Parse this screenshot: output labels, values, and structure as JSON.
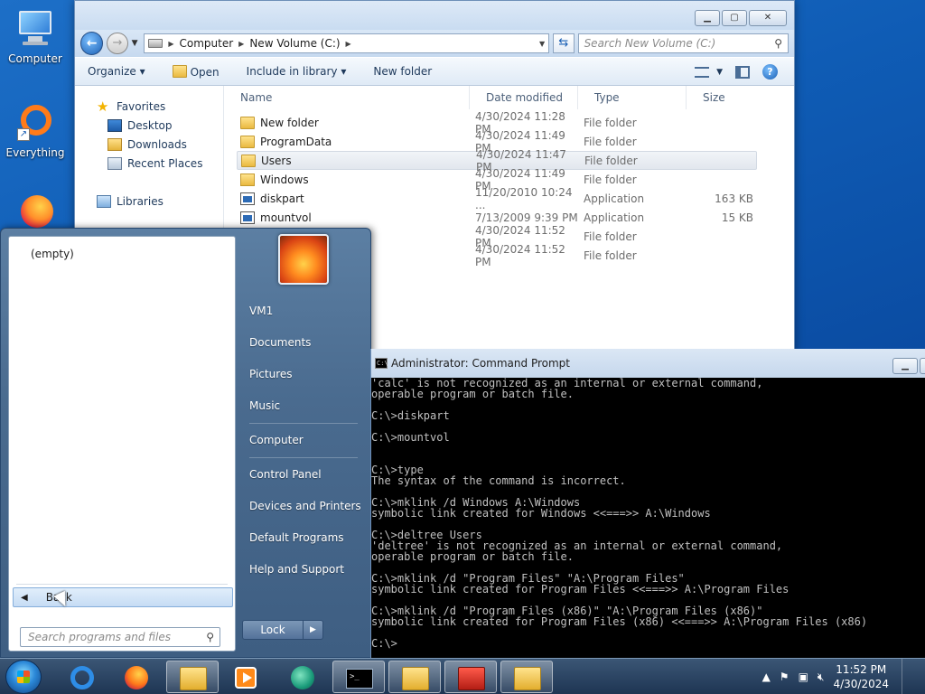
{
  "desktop": {
    "icons": [
      {
        "label": "Computer"
      },
      {
        "label": "Everything"
      }
    ]
  },
  "explorer": {
    "breadcrumb": [
      "Computer",
      "New Volume (C:)"
    ],
    "search_placeholder": "Search New Volume (C:)",
    "toolbar": {
      "organize": "Organize",
      "open": "Open",
      "include": "Include in library",
      "new_folder": "New folder"
    },
    "nav": {
      "favorites": "Favorites",
      "desktop": "Desktop",
      "downloads": "Downloads",
      "recent": "Recent Places",
      "libraries": "Libraries"
    },
    "columns": {
      "name": "Name",
      "date": "Date modified",
      "type": "Type",
      "size": "Size"
    },
    "files": [
      {
        "name": "New folder",
        "date": "4/30/2024 11:28 PM",
        "type": "File folder",
        "size": "",
        "icon": "folder"
      },
      {
        "name": "ProgramData",
        "date": "4/30/2024 11:49 PM",
        "type": "File folder",
        "size": "",
        "icon": "folder"
      },
      {
        "name": "Users",
        "date": "4/30/2024 11:47 PM",
        "type": "File folder",
        "size": "",
        "icon": "folder",
        "selected": true
      },
      {
        "name": "Windows",
        "date": "4/30/2024 11:49 PM",
        "type": "File folder",
        "size": "",
        "icon": "folder-link"
      },
      {
        "name": "diskpart",
        "date": "11/20/2010 10:24 ...",
        "type": "Application",
        "size": "163 KB",
        "icon": "app"
      },
      {
        "name": "mountvol",
        "date": "7/13/2009 9:39 PM",
        "type": "Application",
        "size": "15 KB",
        "icon": "app"
      },
      {
        "name": "",
        "date": "4/30/2024 11:52 PM",
        "type": "File folder",
        "size": "",
        "icon": "none"
      },
      {
        "name": "",
        "date": "4/30/2024 11:52 PM",
        "type": "File folder",
        "size": "",
        "icon": "none"
      }
    ]
  },
  "start_menu": {
    "empty_label": "(empty)",
    "back_label": "Back",
    "search_placeholder": "Search programs and files",
    "right_items": [
      "VM1",
      "Documents",
      "Pictures",
      "Music",
      "Computer",
      "Control Panel",
      "Devices and Printers",
      "Default Programs",
      "Help and Support"
    ],
    "lock_label": "Lock"
  },
  "cmd": {
    "title": "Administrator: Command Prompt",
    "output": "'calc' is not recognized as an internal or external command,\noperable program or batch file.\n\nC:\\>diskpart\n\nC:\\>mountvol\n\n\nC:\\>type\nThe syntax of the command is incorrect.\n\nC:\\>mklink /d Windows A:\\Windows\nsymbolic link created for Windows <<===>> A:\\Windows\n\nC:\\>deltree Users\n'deltree' is not recognized as an internal or external command,\noperable program or batch file.\n\nC:\\>mklink /d \"Program Files\" \"A:\\Program Files\"\nsymbolic link created for Program Files <<===>> A:\\Program Files\n\nC:\\>mklink /d \"Program Files (x86)\" \"A:\\Program Files (x86)\"\nsymbolic link created for Program Files (x86) <<===>> A:\\Program Files (x86)\n\nC:\\>"
  },
  "taskbar": {
    "time": "11:52 PM",
    "date": "4/30/2024"
  }
}
